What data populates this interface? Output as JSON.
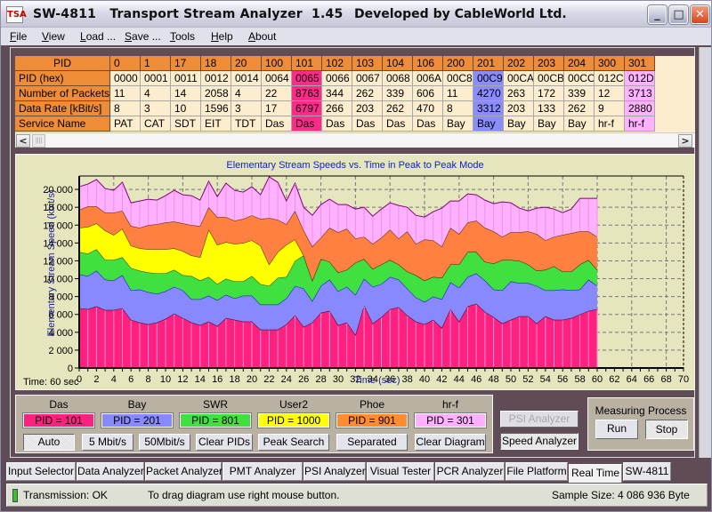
{
  "window": {
    "app_name": "SW-4811",
    "title": "Transport Stream Analyzer  1.45",
    "developer": "Developed by CableWorld Ltd.",
    "controls": {
      "minimize": "_",
      "maximize": "□",
      "close": "✕"
    }
  },
  "menu": [
    {
      "label": "File",
      "accel": "F",
      "rest": "ile"
    },
    {
      "label": "View",
      "accel": "V",
      "rest": "iew"
    },
    {
      "label": "Load ...",
      "accel": "L",
      "rest": "oad ..."
    },
    {
      "label": "Save ...",
      "accel": "S",
      "rest": "ave ..."
    },
    {
      "label": "Tools",
      "accel": "T",
      "rest": "ools"
    },
    {
      "label": "Help",
      "accel": "H",
      "rest": "elp"
    },
    {
      "label": "About",
      "accel": "A",
      "rest": "bout"
    }
  ],
  "pid_table": {
    "row_labels": [
      "PID",
      "PID (hex)",
      "Number of Packets",
      "Data Rate [kBit/s]",
      "Service Name"
    ],
    "columns": [
      {
        "pid": "0",
        "hex": "0000",
        "packets": "11",
        "rate": "8",
        "service": "PAT",
        "highlight": ""
      },
      {
        "pid": "1",
        "hex": "0001",
        "packets": "4",
        "rate": "3",
        "service": "CAT",
        "highlight": ""
      },
      {
        "pid": "17",
        "hex": "0011",
        "packets": "14",
        "rate": "10",
        "service": "SDT",
        "highlight": ""
      },
      {
        "pid": "18",
        "hex": "0012",
        "packets": "2058",
        "rate": "1596",
        "service": "EIT",
        "highlight": ""
      },
      {
        "pid": "20",
        "hex": "0014",
        "packets": "4",
        "rate": "3",
        "service": "TDT",
        "highlight": ""
      },
      {
        "pid": "100",
        "hex": "0064",
        "packets": "22",
        "rate": "17",
        "service": "Das",
        "highlight": ""
      },
      {
        "pid": "101",
        "hex": "0065",
        "packets": "8763",
        "rate": "6797",
        "service": "Das",
        "highlight": "pink"
      },
      {
        "pid": "102",
        "hex": "0066",
        "packets": "344",
        "rate": "266",
        "service": "Das",
        "highlight": ""
      },
      {
        "pid": "103",
        "hex": "0067",
        "packets": "262",
        "rate": "203",
        "service": "Das",
        "highlight": ""
      },
      {
        "pid": "104",
        "hex": "0068",
        "packets": "339",
        "rate": "262",
        "service": "Das",
        "highlight": ""
      },
      {
        "pid": "106",
        "hex": "006A",
        "packets": "606",
        "rate": "470",
        "service": "Das",
        "highlight": ""
      },
      {
        "pid": "200",
        "hex": "00C8",
        "packets": "11",
        "rate": "8",
        "service": "Bay",
        "highlight": ""
      },
      {
        "pid": "201",
        "hex": "00C9",
        "packets": "4270",
        "rate": "3312",
        "service": "Bay",
        "highlight": "blue"
      },
      {
        "pid": "202",
        "hex": "00CA",
        "packets": "263",
        "rate": "203",
        "service": "Bay",
        "highlight": ""
      },
      {
        "pid": "203",
        "hex": "00CB",
        "packets": "172",
        "rate": "133",
        "service": "Bay",
        "highlight": ""
      },
      {
        "pid": "204",
        "hex": "00CC",
        "packets": "339",
        "rate": "262",
        "service": "Bay",
        "highlight": ""
      },
      {
        "pid": "300",
        "hex": "012C",
        "packets": "12",
        "rate": "9",
        "service": "hr-f",
        "highlight": ""
      },
      {
        "pid": "301",
        "hex": "012D",
        "packets": "3713",
        "rate": "2880",
        "service": "hr-f",
        "highlight": "magenta"
      }
    ],
    "scroll_left": "<",
    "scroll_right": ">"
  },
  "chart_data": {
    "type": "area",
    "stacked": true,
    "title": "Elementary Stream Speeds vs. Time in Peak to Peak Mode",
    "xlabel": "Time (sec)",
    "ylabel": "Elementary Stream Speed (kbit/s)",
    "xlim": [
      0,
      70
    ],
    "ylim": [
      0,
      21500
    ],
    "x_ticks": [
      0,
      2,
      4,
      6,
      8,
      10,
      12,
      14,
      16,
      18,
      20,
      22,
      24,
      26,
      28,
      30,
      32,
      34,
      36,
      38,
      40,
      42,
      44,
      46,
      48,
      50,
      52,
      54,
      56,
      58,
      60,
      62,
      64,
      66,
      68,
      70
    ],
    "y_ticks": [
      0,
      2000,
      4000,
      6000,
      8000,
      10000,
      12000,
      14000,
      16000,
      18000,
      20000
    ],
    "y_tick_labels": [
      "0",
      "2 000",
      "4 000",
      "6 000",
      "8 000",
      "10 000",
      "12 000",
      "14 000",
      "16 000",
      "18 000",
      "20 000"
    ],
    "grid": true,
    "x": [
      0,
      1,
      2,
      3,
      4,
      5,
      6,
      7,
      8,
      9,
      10,
      11,
      12,
      13,
      14,
      15,
      16,
      17,
      18,
      19,
      20,
      21,
      22,
      23,
      24,
      25,
      26,
      27,
      28,
      29,
      30,
      31,
      32,
      33,
      34,
      35,
      36,
      37,
      38,
      39,
      40,
      41,
      42,
      43,
      44,
      45,
      46,
      47,
      48,
      49,
      50,
      51,
      52,
      53,
      54,
      55,
      56,
      57,
      58,
      59,
      60
    ],
    "series": [
      {
        "name": "Das",
        "pid": "101",
        "color": "#ff2080",
        "values": [
          6700,
          6600,
          6900,
          6500,
          6500,
          6700,
          5400,
          5100,
          4900,
          5100,
          5500,
          6100,
          5600,
          5100,
          4800,
          5200,
          4700,
          5600,
          5400,
          5200,
          5200,
          4300,
          4300,
          4300,
          4900,
          5900,
          4600,
          5100,
          6200,
          6400,
          4800,
          5100,
          3700,
          7000,
          5000,
          5700,
          6600,
          6800,
          5900,
          5200,
          4900,
          5400,
          4500,
          6600,
          5200,
          6900,
          7200,
          6300,
          5700,
          5000,
          5400,
          5800,
          5800,
          5000,
          5800,
          5400,
          5400,
          5600,
          6000,
          6400,
          6600
        ]
      },
      {
        "name": "Bay",
        "pid": "201",
        "color": "#8888ff",
        "values": [
          3800,
          3700,
          4000,
          3400,
          3300,
          3700,
          3300,
          3700,
          3600,
          3200,
          3100,
          3000,
          3100,
          2600,
          2900,
          2900,
          2900,
          2600,
          2400,
          2900,
          2900,
          2800,
          2800,
          2800,
          2900,
          3300,
          4300,
          2400,
          3000,
          3500,
          3800,
          4000,
          4500,
          3000,
          4100,
          3700,
          3600,
          3100,
          3000,
          2700,
          2500,
          2600,
          3200,
          3000,
          3800,
          3300,
          3400,
          3500,
          3100,
          3700,
          4300,
          3700,
          3700,
          4200,
          2900,
          3300,
          3400,
          3100,
          2800,
          3500,
          2600
        ]
      },
      {
        "name": "SWR",
        "pid": "801",
        "color": "#40e040",
        "values": [
          2500,
          2500,
          2400,
          2200,
          2300,
          2000,
          2500,
          2100,
          2200,
          2300,
          2000,
          1900,
          1700,
          2600,
          2100,
          2100,
          1800,
          1800,
          1900,
          1600,
          2200,
          2300,
          2100,
          3000,
          2400,
          2800,
          3700,
          2300,
          3000,
          2000,
          2100,
          1900,
          3600,
          2200,
          2000,
          2200,
          1900,
          1700,
          1900,
          2500,
          2400,
          2200,
          2400,
          2000,
          2600,
          2800,
          2400,
          2100,
          2900,
          3400,
          2400,
          2500,
          2100,
          1700,
          2300,
          2700,
          2000,
          2100,
          2800,
          2200,
          1800
        ]
      },
      {
        "name": "User2",
        "pid": "1000",
        "color": "#ffff00",
        "values": [
          2700,
          3000,
          2900,
          3300,
          2800,
          3200,
          2500,
          2500,
          2600,
          2700,
          2700,
          2400,
          2700,
          2300,
          2600,
          5300,
          4400,
          4100,
          4200,
          4300,
          4000,
          4300,
          2400,
          2900,
          3600,
          2400,
          0,
          0,
          0,
          0,
          0,
          0,
          0,
          0,
          0,
          0,
          0,
          0,
          0,
          0,
          0,
          0,
          0,
          0,
          0,
          0,
          0,
          0,
          0,
          0,
          0,
          0,
          0,
          0,
          0,
          0,
          0,
          0,
          0,
          0,
          0
        ]
      },
      {
        "name": "Phoe",
        "pid": "901",
        "color": "#ff8040",
        "values": [
          2000,
          2300,
          1900,
          2000,
          2500,
          2000,
          2200,
          2300,
          2700,
          2800,
          3000,
          3000,
          3100,
          3400,
          3500,
          2500,
          3100,
          2800,
          2600,
          2700,
          2800,
          3000,
          5200,
          3600,
          2300,
          3200,
          2800,
          3800,
          2400,
          3800,
          4500,
          4600,
          2700,
          2500,
          2800,
          3000,
          3400,
          2900,
          4500,
          3500,
          4600,
          4100,
          3500,
          4100,
          3400,
          3300,
          3500,
          3800,
          3600,
          2600,
          3100,
          3200,
          3700,
          4100,
          3300,
          3300,
          4100,
          4300,
          3700,
          3200,
          3700
        ]
      },
      {
        "name": "hr-f",
        "pid": "301",
        "color": "#ffb0ff",
        "values": [
          2600,
          2500,
          3000,
          2700,
          2500,
          3200,
          2600,
          3000,
          2900,
          2700,
          3000,
          3500,
          3200,
          3300,
          2900,
          2900,
          2300,
          3800,
          3400,
          3000,
          3200,
          2700,
          4600,
          4200,
          2600,
          3100,
          2600,
          3500,
          3700,
          3200,
          3100,
          2700,
          3300,
          3300,
          3100,
          3200,
          3000,
          3700,
          2700,
          3200,
          2500,
          3200,
          4300,
          3000,
          3700,
          3200,
          2900,
          3100,
          3100,
          3900,
          3300,
          2700,
          2300,
          2900,
          3700,
          3100,
          2500,
          2700,
          3700,
          3700,
          4300
        ]
      }
    ]
  },
  "chart_info": {
    "time_readout": "Time: 60 sec"
  },
  "legend": [
    {
      "name": "Das",
      "box": "PID = 101",
      "color": "#ff2080"
    },
    {
      "name": "Bay",
      "box": "PID = 201",
      "color": "#8888ff"
    },
    {
      "name": "SWR",
      "box": "PID = 801",
      "color": "#40e040"
    },
    {
      "name": "User2",
      "box": "PID = 1000",
      "color": "#ffff00"
    },
    {
      "name": "Phoe",
      "box": "PID = 901",
      "color": "#ff8c30"
    },
    {
      "name": "hr-f",
      "box": "PID = 301",
      "color": "#ffb0ff"
    }
  ],
  "legend_buttons": [
    "Auto",
    "5 Mbit/s",
    "50Mbit/s",
    "Clear PIDs",
    "Peak Search",
    "Separated",
    "Clear Diagram"
  ],
  "mode_buttons": {
    "psi": "PSI Analyzer",
    "speed": "Speed Analyzer"
  },
  "measuring": {
    "title": "Measuring Process",
    "run": "Run",
    "stop": "Stop"
  },
  "tabs": [
    "Input Selector",
    "Data Analyzer",
    "Packet Analyzer",
    "PMT Analyzer",
    "PSI Analyzer",
    "Visual Tester",
    "PCR Analyzer",
    "File Platform",
    "Real Time",
    "SW-4811"
  ],
  "active_tab": "Real Time",
  "status": {
    "transmission": "Transmission: OK",
    "hint": "To drag diagram use right mouse button.",
    "sample_size": "Sample Size: 4 086 936 Byte"
  }
}
